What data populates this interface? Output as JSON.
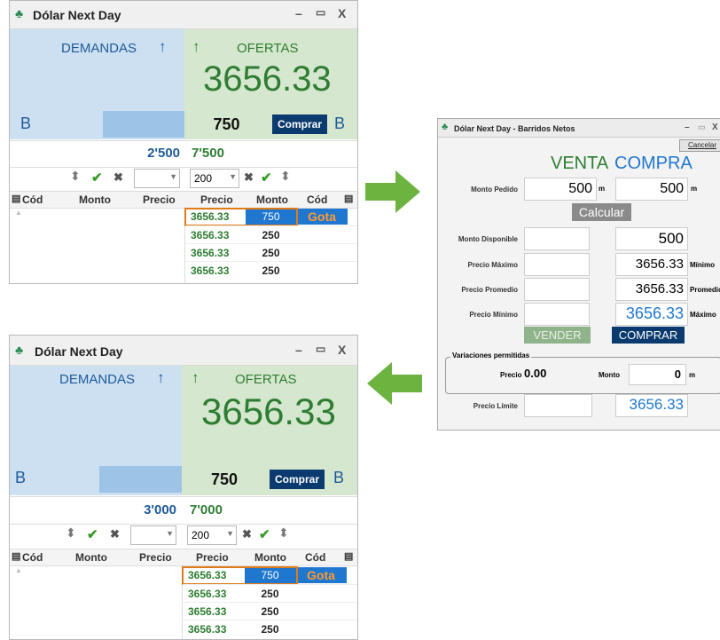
{
  "window1": {
    "title": "Dólar Next Day",
    "demandas": "DEMANDAS",
    "ofertas": "OFERTAS",
    "arrow_up": "↑",
    "price": "3656.33",
    "b_left": "B",
    "b_right": "B",
    "qty": "750",
    "comprar": "Comprar",
    "total_demand": "2'500",
    "total_offer": "7'500",
    "qty_select": "200",
    "headers_left": [
      "Cód",
      "Monto",
      "Precio"
    ],
    "headers_right": [
      "Precio",
      "Monto",
      "Cód"
    ],
    "rows": [
      {
        "precio": "3656.33",
        "monto": "750",
        "cod": "Gota"
      },
      {
        "precio": "3656.33",
        "monto": "250",
        "cod": ""
      },
      {
        "precio": "3656.33",
        "monto": "250",
        "cod": ""
      },
      {
        "precio": "3656.33",
        "monto": "250",
        "cod": ""
      }
    ]
  },
  "window2": {
    "title": "Dólar Next Day",
    "demandas": "DEMANDAS",
    "ofertas": "OFERTAS",
    "arrow_up": "↑",
    "price": "3656.33",
    "b_left": "B",
    "b_right": "B",
    "qty": "750",
    "comprar": "Comprar",
    "total_demand": "3'000",
    "total_offer": "7'000",
    "qty_select": "200",
    "headers_left": [
      "Cód",
      "Monto",
      "Precio"
    ],
    "headers_right": [
      "Precio",
      "Monto",
      "Cód"
    ],
    "rows": [
      {
        "precio": "3656.33",
        "monto": "750",
        "cod": "Gota"
      },
      {
        "precio": "3656.33",
        "monto": "250",
        "cod": ""
      },
      {
        "precio": "3656.33",
        "monto": "250",
        "cod": ""
      },
      {
        "precio": "3656.33",
        "monto": "250",
        "cod": ""
      }
    ]
  },
  "dialog": {
    "title": "Dólar Next Day - Barridos Netos",
    "cancelar": "Cancelar",
    "venta": "VENTA",
    "compra": "COMPRA",
    "monto_pedido_label": "Monto Pedido",
    "monto_pedido_venta": "500",
    "monto_pedido_compra": "500",
    "unit_m": "m",
    "calcular": "Calcular",
    "monto_disponible_label": "Monto Disponible",
    "monto_disponible_compra": "500",
    "precio_maximo_label": "Precio Máximo",
    "precio_maximo_compra": "3656.33",
    "minimo_label": "Mínimo",
    "precio_promedio_label": "Precio Promedio",
    "precio_promedio_compra": "3656.33",
    "promedio_label": "Promedio",
    "precio_minimo_label": "Precio Mínimo",
    "precio_minimo_compra": "3656.33",
    "maximo_label": "Máximo",
    "vender": "VENDER",
    "comprar": "COMPRAR",
    "variaciones_label": "Variaciones permitidas",
    "precio_label": "Precio",
    "precio_value": "0.00",
    "monto_label": "Monto",
    "monto_value": "0",
    "precio_limite_label": "Precio Límite",
    "precio_limite_compra": "3656.33"
  },
  "colors": {
    "accent_green": "#2e7d32",
    "accent_blue": "#1f5a99",
    "arrow_green": "#6db33f",
    "selection_orange": "#e07b1a"
  }
}
